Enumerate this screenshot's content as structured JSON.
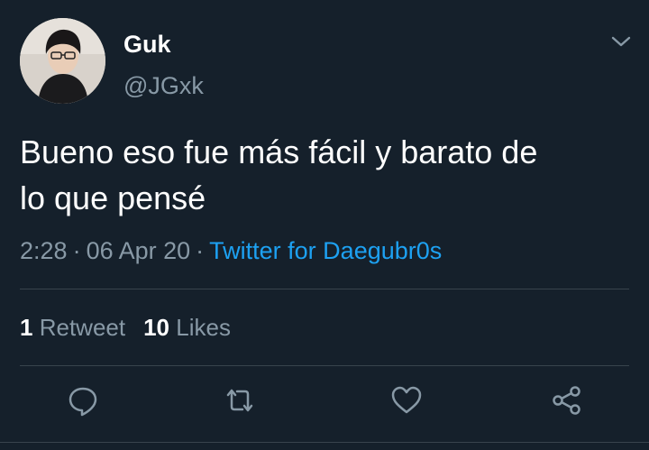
{
  "user": {
    "display_name": "Guk",
    "handle": "@JGxk"
  },
  "tweet": {
    "text_line1": "Bueno eso fue más fácil y barato de",
    "text_line2": "lo que pensé",
    "time": "2:28",
    "date": "06 Apr 20",
    "separator": "·",
    "source": "Twitter for Daegubr0s"
  },
  "stats": {
    "retweets_count": "1",
    "retweets_label": "Retweet",
    "likes_count": "10",
    "likes_label": "Likes"
  },
  "icons": {
    "more": "chevron-down-icon",
    "reply": "reply-icon",
    "retweet": "retweet-icon",
    "like": "heart-icon",
    "share": "share-icon"
  },
  "colors": {
    "background": "#15202b",
    "secondary_text": "#8899a6",
    "link": "#1da1f2",
    "divider": "#38444d"
  }
}
